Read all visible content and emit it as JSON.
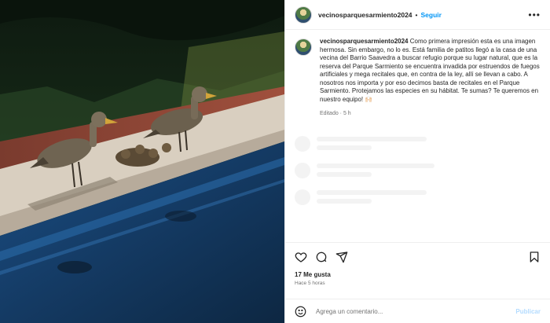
{
  "header": {
    "username": "vecinosparquesarmiento2024",
    "separator": "•",
    "follow_label": "Seguir",
    "more_icon": "more-horizontal-icon"
  },
  "caption": {
    "username": "vecinosparquesarmiento2024",
    "text": "Como primera impresión esta es una imagen hermosa. Sin embargo, no lo es. Está familia de patitos llegó a la casa de una vecina del Barrio Saavedra a buscar refugio porque su lugar natural, que es la reserva del Parque Sarmiento se encuentra invadida por estruendos de fuegos artificiales y mega recitales que, en contra de la ley, allí se llevan a cabo. A nosotros nos importa y por eso decimos basta de recitales en el Parque Sarmiento. Protejamos las especies en su hábitat. Te sumas? Te queremos en nuestro equipo! 🙌🏻",
    "meta": "Editado · 5 h"
  },
  "actions": {
    "icons": [
      "heart-icon",
      "comment-icon",
      "share-icon",
      "bookmark-icon"
    ],
    "likes": "17 Me gusta",
    "time": "Hace 5 horas"
  },
  "comment_box": {
    "emoji_icon": "emoji-icon",
    "placeholder": "Agrega un comentario...",
    "publish_label": "Publicar"
  }
}
